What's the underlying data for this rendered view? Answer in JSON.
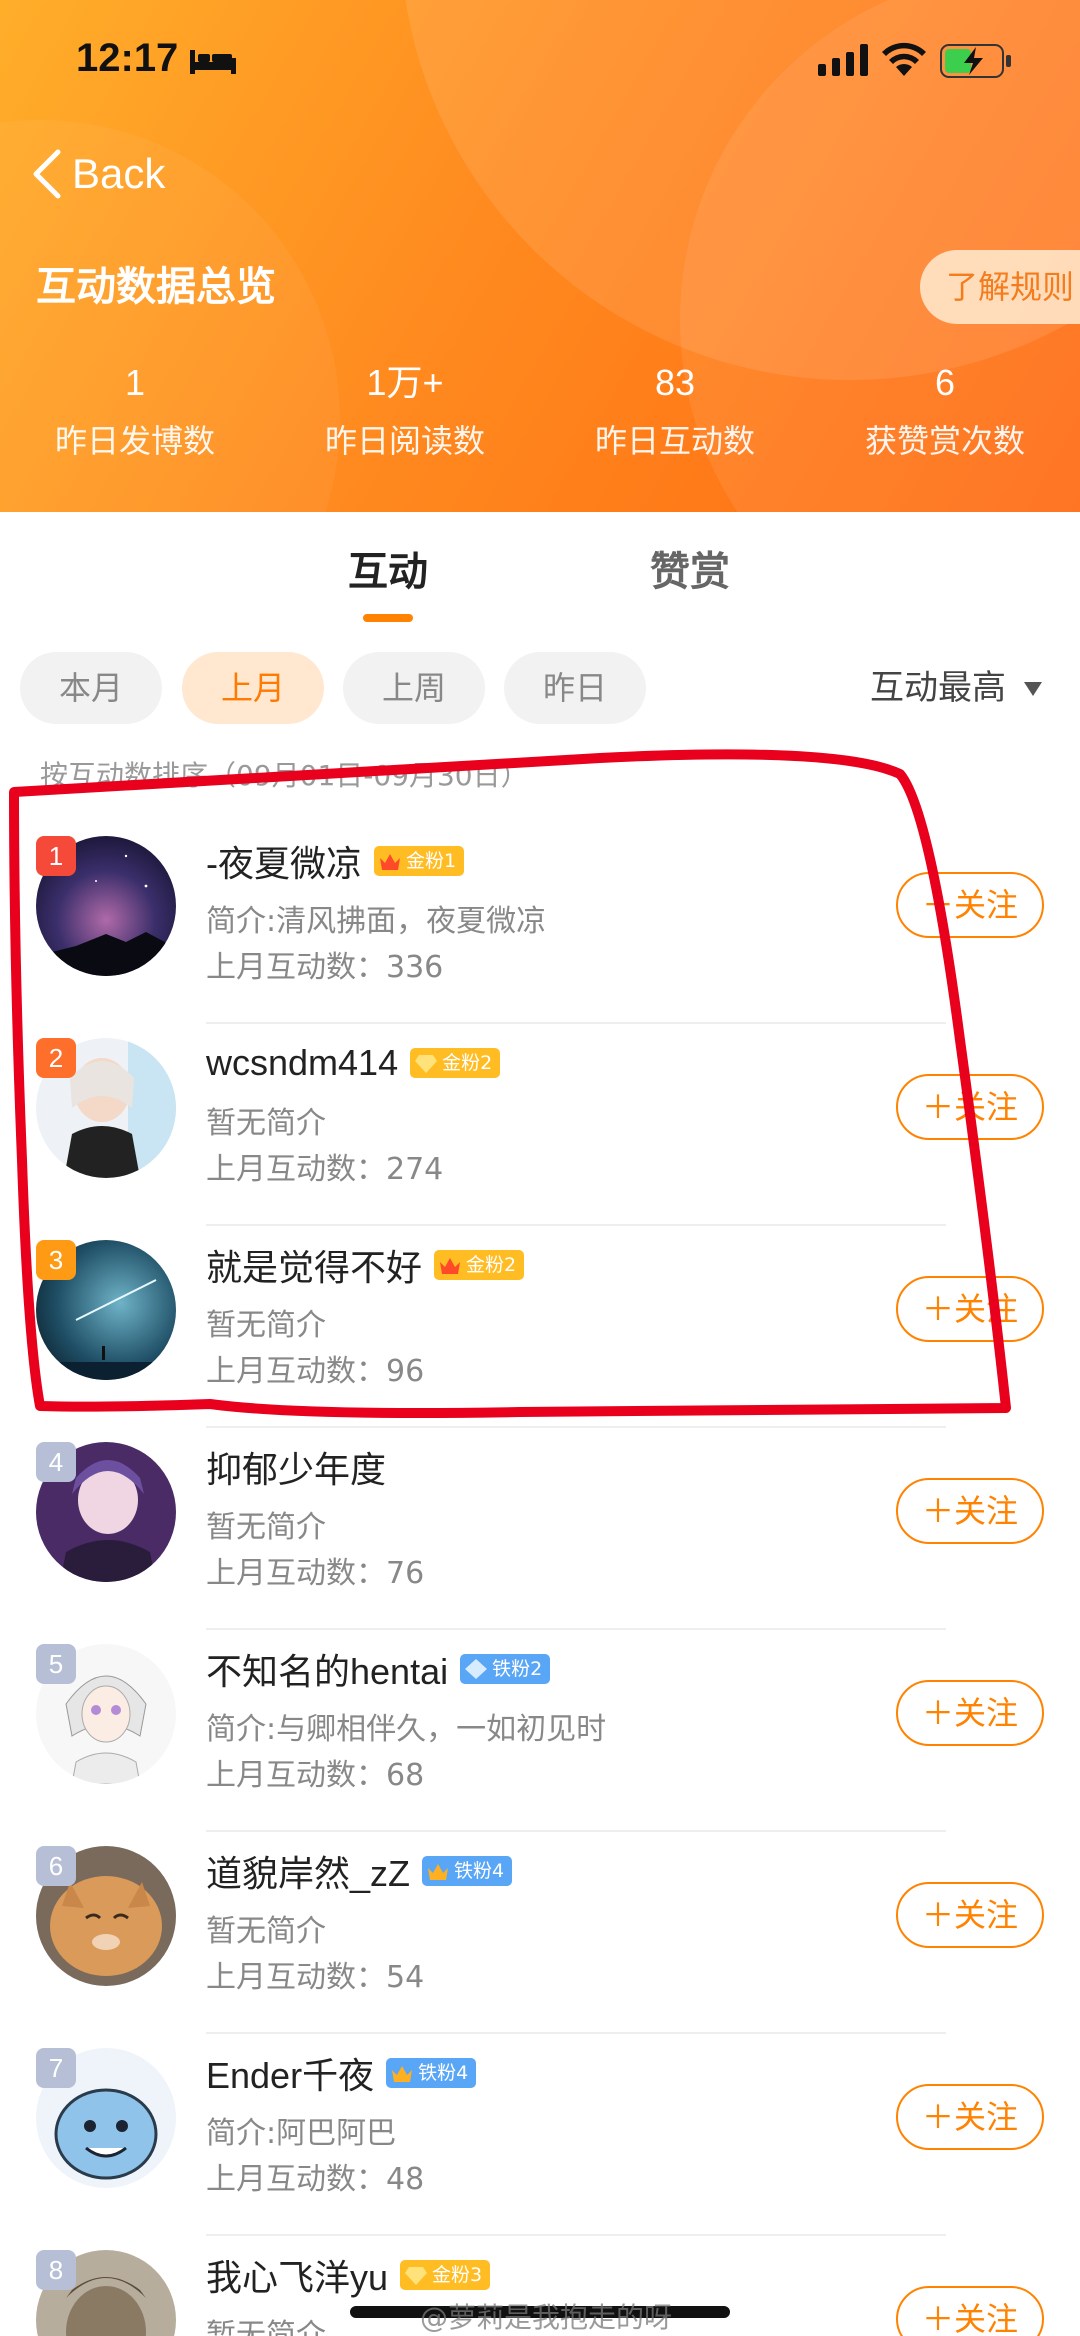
{
  "status_bar": {
    "time": "12:17"
  },
  "nav": {
    "back_label": "Back"
  },
  "header": {
    "title": "互动数据总览",
    "rules_button": "了解规则",
    "stats": [
      {
        "value": "1",
        "label": "昨日发博数"
      },
      {
        "value": "1万+",
        "label": "昨日阅读数"
      },
      {
        "value": "83",
        "label": "昨日互动数"
      },
      {
        "value": "6",
        "label": "获赞赏次数"
      }
    ]
  },
  "tabs": {
    "active": "互动",
    "inactive": "赞赏"
  },
  "filters": {
    "chips": [
      {
        "label": "本月",
        "active": false
      },
      {
        "label": "上月",
        "active": true
      },
      {
        "label": "上周",
        "active": false
      },
      {
        "label": "昨日",
        "active": false
      }
    ],
    "sort_label": "互动最高"
  },
  "sort_hint": "按互动数排序（09月01日-09月30日）",
  "list": [
    {
      "rank": "1",
      "name": "-夜夏微凉",
      "badge": "金粉1",
      "badge_type": "gold",
      "bio": "简介:清风拂面，夜夏微凉",
      "count": "上月互动数：336",
      "follow": "＋关注"
    },
    {
      "rank": "2",
      "name": "wcsndm414",
      "badge": "金粉2",
      "badge_type": "gold",
      "bio": "暂无简介",
      "count": "上月互动数：274",
      "follow": "＋关注"
    },
    {
      "rank": "3",
      "name": "就是觉得不好",
      "badge": "金粉2",
      "badge_type": "gold",
      "bio": "暂无简介",
      "count": "上月互动数：96",
      "follow": "＋关注"
    },
    {
      "rank": "4",
      "name": "抑郁少年度",
      "badge": "",
      "badge_type": "",
      "bio": "暂无简介",
      "count": "上月互动数：76",
      "follow": "＋关注"
    },
    {
      "rank": "5",
      "name": "不知名的hentai",
      "badge": "铁粉2",
      "badge_type": "iron",
      "bio": "简介:与卿相伴久，一如初见时",
      "count": "上月互动数：68",
      "follow": "＋关注"
    },
    {
      "rank": "6",
      "name": "道貌岸然_zZ",
      "badge": "铁粉4",
      "badge_type": "iron",
      "bio": "暂无简介",
      "count": "上月互动数：54",
      "follow": "＋关注"
    },
    {
      "rank": "7",
      "name": "Ender千夜",
      "badge": "铁粉4",
      "badge_type": "iron",
      "bio": "简介:阿巴阿巴",
      "count": "上月互动数：48",
      "follow": "＋关注"
    },
    {
      "rank": "8",
      "name": "我心飞洋yu",
      "badge": "金粉3",
      "badge_type": "gold",
      "bio": "暂无简介",
      "count": "",
      "follow": "＋关注"
    }
  ],
  "watermark": "@萝莉是我抱走的呀",
  "colors": {
    "accent": "#ff8200",
    "header_gradient_start": "#ffae2a",
    "header_gradient_end": "#ff6a12",
    "annotation": "#e8001c"
  }
}
